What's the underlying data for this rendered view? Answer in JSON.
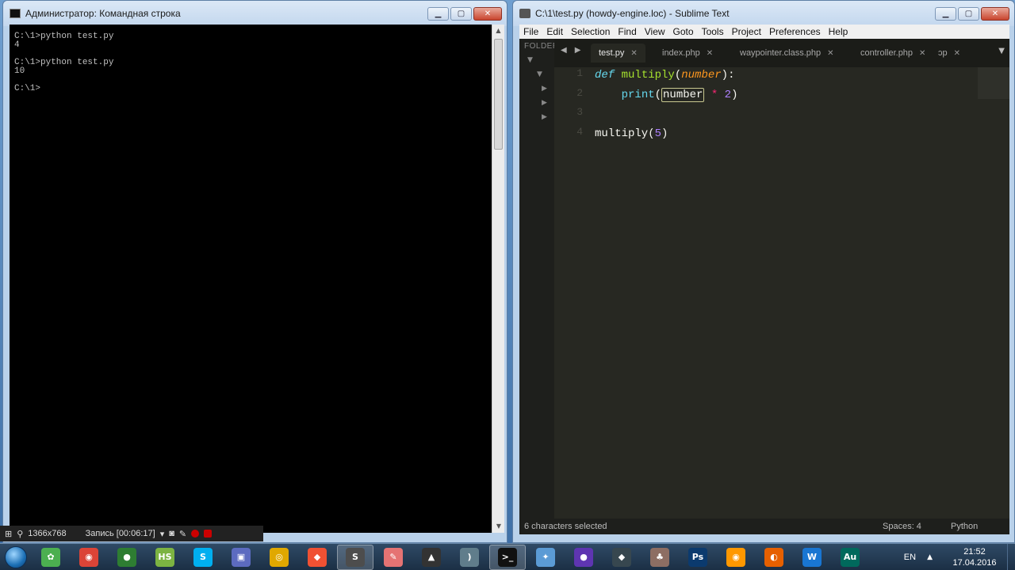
{
  "cmd": {
    "title": "Администратор: Командная строка",
    "lines": [
      "C:\\1>python test.py",
      "4",
      "",
      "C:\\1>python test.py",
      "10",
      "",
      "C:\\1>"
    ]
  },
  "recorder": {
    "resolution": "1366x768",
    "status": "Запись [00:06:17]"
  },
  "sublime": {
    "title": "C:\\1\\test.py (howdy-engine.loc) - Sublime Text",
    "menu": [
      "File",
      "Edit",
      "Selection",
      "Find",
      "View",
      "Goto",
      "Tools",
      "Project",
      "Preferences",
      "Help"
    ],
    "sidebar_header": "FOLDER",
    "tabs": [
      {
        "label": "test.py",
        "active": true
      },
      {
        "label": "index.php",
        "active": false
      },
      {
        "label": "waypointer.class.php",
        "active": false
      },
      {
        "label": "controller.php",
        "active": false
      },
      {
        "label": "ɔp",
        "active": false
      }
    ],
    "line_numbers": [
      "1",
      "2",
      "3",
      "4"
    ],
    "code": {
      "l1_def": "def",
      "l1_fn": "multiply",
      "l1_open": "(",
      "l1_arg": "number",
      "l1_close": "):",
      "l2_print": "print",
      "l2_open": "(",
      "l2_arg": "number",
      "l2_op": "*",
      "l2_num": "2",
      "l2_close": ")",
      "l4_call": "multiply",
      "l4_open": "(",
      "l4_num": "5",
      "l4_close": ")"
    },
    "status": {
      "selection": "6 characters selected",
      "spaces": "Spaces: 4",
      "syntax": "Python"
    }
  },
  "taskbar": {
    "apps": [
      {
        "icon": "leaf-app-icon",
        "color": "#4caf50",
        "glyph": "✿"
      },
      {
        "icon": "chrome-icon",
        "color": "#db4437",
        "glyph": "◉"
      },
      {
        "icon": "globe-app-icon",
        "color": "#2e7d32",
        "glyph": "●"
      },
      {
        "icon": "hs-app-icon",
        "color": "#7cb342",
        "glyph": "HS"
      },
      {
        "icon": "skype-icon",
        "color": "#00aff0",
        "glyph": "S"
      },
      {
        "icon": "window-app-icon",
        "color": "#5c6bc0",
        "glyph": "▣"
      },
      {
        "icon": "disc-app-icon",
        "color": "#e0a800",
        "glyph": "◎"
      },
      {
        "icon": "git-icon",
        "color": "#f05133",
        "glyph": "◆"
      },
      {
        "icon": "sublime-icon",
        "color": "#4d4d4d",
        "glyph": "S"
      },
      {
        "icon": "paint-app-icon",
        "color": "#e57373",
        "glyph": "✎"
      },
      {
        "icon": "triangle-app-icon",
        "color": "#333333",
        "glyph": "▲"
      },
      {
        "icon": "arc-app-icon",
        "color": "#607d8b",
        "glyph": ")"
      },
      {
        "icon": "cmd-icon",
        "color": "#111111",
        "glyph": ">_"
      },
      {
        "icon": "tool-app-icon",
        "color": "#5b9bd5",
        "glyph": "✦"
      },
      {
        "icon": "media-app-icon",
        "color": "#5e35b1",
        "glyph": "●"
      },
      {
        "icon": "cube-app-icon",
        "color": "#37474f",
        "glyph": "◆"
      },
      {
        "icon": "pineapple-app-icon",
        "color": "#8d6e63",
        "glyph": "♣"
      },
      {
        "icon": "photoshop-icon",
        "color": "#0b3a6e",
        "glyph": "Ps"
      },
      {
        "icon": "orange-app-icon",
        "color": "#ff9800",
        "glyph": "◉"
      },
      {
        "icon": "firefox-icon",
        "color": "#e66000",
        "glyph": "◐"
      },
      {
        "icon": "wifi-app-icon",
        "color": "#1976d2",
        "glyph": "W"
      },
      {
        "icon": "audition-icon",
        "color": "#00695c",
        "glyph": "Au"
      }
    ],
    "active_apps": [
      8,
      12
    ],
    "lang": "EN",
    "time": "21:52",
    "date": "17.04.2016"
  }
}
